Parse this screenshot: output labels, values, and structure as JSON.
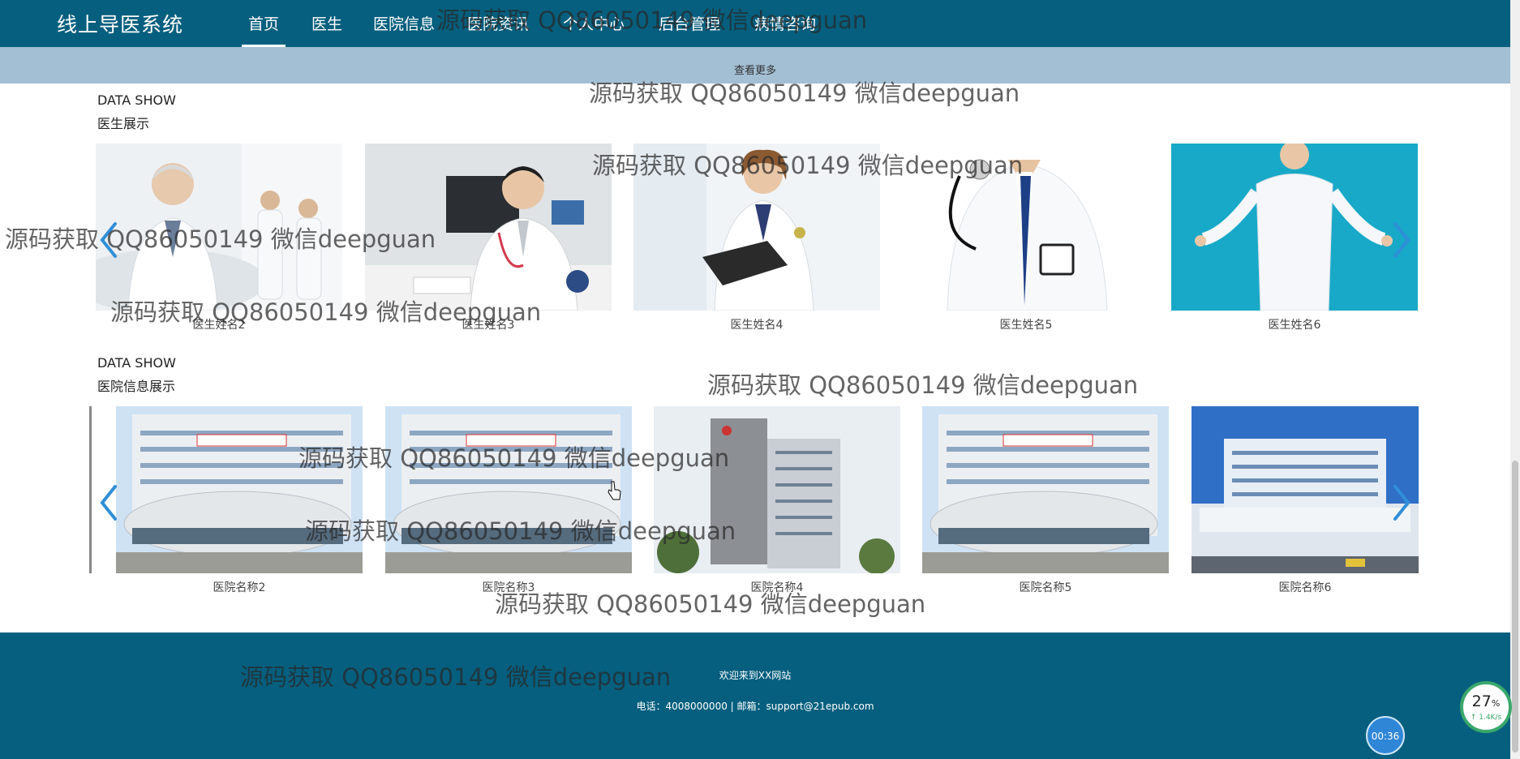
{
  "header": {
    "brand": "线上导医系统",
    "nav": [
      "首页",
      "医生",
      "医院信息",
      "医院资讯",
      "个人中心",
      "后台管理",
      "病情咨询"
    ]
  },
  "more_band": {
    "label": "查看更多"
  },
  "doctors_section": {
    "title_en": "DATA SHOW",
    "title_cn": "医生展示",
    "items": [
      "医生姓名2",
      "医生姓名3",
      "医生姓名4",
      "医生姓名5",
      "医生姓名6"
    ]
  },
  "hospital_section": {
    "title_en": "DATA SHOW",
    "title_cn": "医院信息展示",
    "items": [
      "医院名称2",
      "医院名称3",
      "医院名称4",
      "医院名称5",
      "医院名称6"
    ]
  },
  "footer": {
    "welcome": "欢迎来到XX网站",
    "contact": "电话：4008000000 | 邮箱：support@21epub.com"
  },
  "watermark": "源码获取 QQ86050149 微信deepguan",
  "widgets": {
    "speed_percent": "27",
    "speed_unit": "%",
    "speed_rate": "↑ 1.4K/s",
    "timer": "00:36"
  },
  "colors": {
    "nav_bg": "#065f7e",
    "band_bg": "#a3bfd4",
    "arrow": "#2f8fd8"
  },
  "icons": {
    "prev": "chevron-left-icon",
    "next": "chevron-right-icon"
  }
}
